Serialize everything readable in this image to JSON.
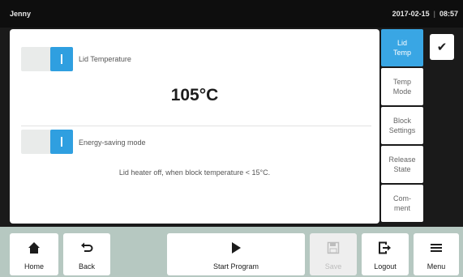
{
  "header": {
    "user": "Jenny",
    "date": "2017-02-15",
    "separator": "|",
    "time": "08:57"
  },
  "panel": {
    "lid_temperature_label": "Lid Temperature",
    "lid_temperature_value": "105°C",
    "energy_saving_label": "Energy-saving mode",
    "energy_saving_note": "Lid heater off, when block temperature < 15°C."
  },
  "tabs": [
    {
      "label": "Lid\nTemp",
      "active": true
    },
    {
      "label": "Temp\nMode",
      "active": false
    },
    {
      "label": "Block\nSettings",
      "active": false
    },
    {
      "label": "Release\nState",
      "active": false
    },
    {
      "label": "Com-\nment",
      "active": false
    }
  ],
  "confirm": {
    "icon": "✔"
  },
  "toolbar": {
    "home": {
      "label": "Home",
      "icon": "home-icon"
    },
    "back": {
      "label": "Back",
      "icon": "back-arrow-icon"
    },
    "start": {
      "label": "Start Program",
      "icon": "play-icon"
    },
    "save": {
      "label": "Save",
      "icon": "save-icon"
    },
    "logout": {
      "label": "Logout",
      "icon": "logout-icon"
    },
    "menu": {
      "label": "Menu",
      "icon": "menu-icon"
    }
  },
  "colors": {
    "accent": "#39a6e4",
    "toggle_on": "#2f9fe0",
    "bottom_bar": "#b6c8c1",
    "top_bar": "#0e0e0e"
  }
}
